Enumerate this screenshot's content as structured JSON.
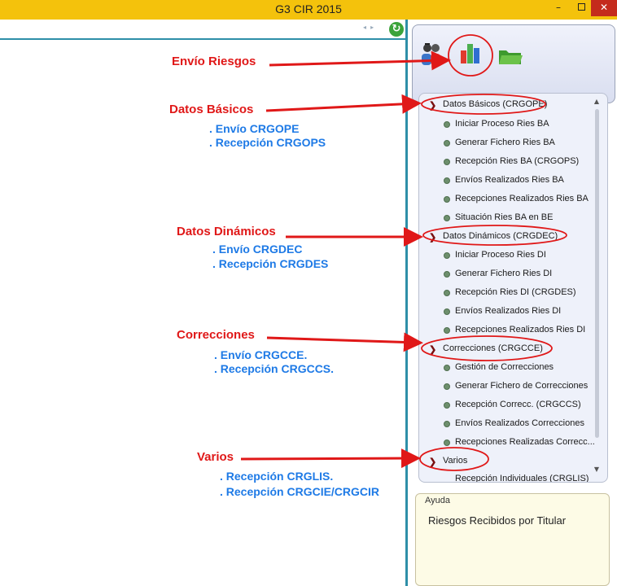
{
  "window": {
    "title": "G3 CIR 2015",
    "min": "–",
    "close": "✕"
  },
  "menu": {
    "sections": [
      {
        "header": "Datos Básicos (CRGOPE)",
        "items": [
          "Iniciar Proceso Ries BA",
          "Generar Fichero Ries BA",
          "Recepción Ries BA (CRGOPS)",
          "Envíos Realizados Ries BA",
          "Recepciones Realizados Ries BA",
          "Situación Ries BA en BE"
        ]
      },
      {
        "header": "Datos Dinámicos (CRGDEC)",
        "items": [
          "Iniciar Proceso Ries DI",
          "Generar Fichero Ries DI",
          "Recepción Ries DI (CRGDES)",
          "Envíos Realizados Ries DI",
          "Recepciones Realizados Ries DI"
        ]
      },
      {
        "header": "Correcciones (CRGCCE)",
        "items": [
          "Gestión de Correcciones",
          "Generar Fichero de Correcciones",
          "Recepción Correcc. (CRGCCS)",
          "Envíos Realizados Correcciones",
          "Recepciones Realizadas Correcc..."
        ]
      },
      {
        "header": "Varios",
        "items": [
          "Recepción Individuales (CRGLIS)"
        ]
      }
    ]
  },
  "help": {
    "title": "Ayuda",
    "text": "Riesgos Recibidos por Titular"
  },
  "annotations": {
    "envio_riesgos": "Envío Riesgos",
    "datos_basicos": {
      "title": "Datos Básicos",
      "lines": [
        ". Envío CRGOPE",
        ". Recepción CRGOPS"
      ]
    },
    "datos_dinamicos": {
      "title": "Datos Dinámicos",
      "lines": [
        ". Envío CRGDEC",
        ". Recepción CRGDES"
      ]
    },
    "correcciones": {
      "title": "Correcciones",
      "lines": [
        ". Envío CRGCCE.",
        ". Recepción CRGCCS."
      ]
    },
    "varios": {
      "title": "Varios",
      "lines": [
        ". Recepción CRGLIS.",
        ". Recepción CRGCIE/CRGCIR"
      ]
    }
  },
  "colors": {
    "titlebar": "#f4c20c",
    "annotation_red": "#e01818",
    "annotation_blue": "#1e7ae6",
    "divider": "#2e8fa8"
  }
}
